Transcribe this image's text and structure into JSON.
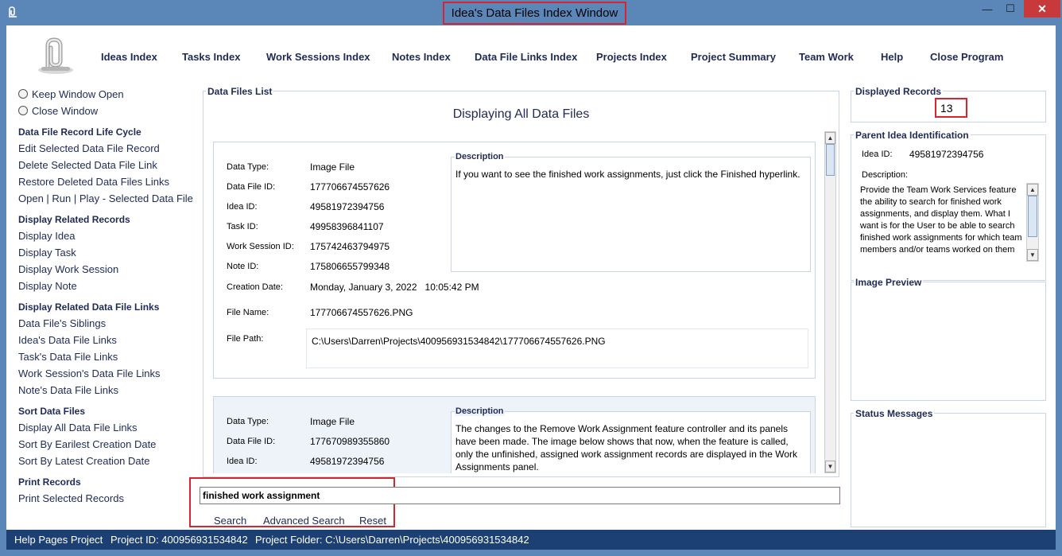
{
  "window": {
    "title": "Idea's Data Files Index Window",
    "minimize": "—",
    "maximize": "☐",
    "close": "✕"
  },
  "nav": {
    "items": [
      "Ideas Index",
      "Tasks Index",
      "Work Sessions Index",
      "Notes Index",
      "Data File Links Index",
      "Projects Index",
      "Project Summary",
      "Team Work",
      "Help",
      "Close Program"
    ]
  },
  "left_panel": {
    "radios": [
      "Keep Window Open",
      "Close Window"
    ],
    "sections": [
      {
        "heading": "Data File Record Life Cycle",
        "links": [
          "Edit Selected Data File Record",
          "Delete Selected Data File Link",
          "Restore Deleted Data Files Links",
          "Open | Run | Play - Selected Data File"
        ]
      },
      {
        "heading": "Display Related Records",
        "links": [
          "Display Idea",
          "Display Task",
          "Display Work Session",
          "Display Note"
        ]
      },
      {
        "heading": "Display Related Data File Links",
        "links": [
          "Data File's Siblings",
          "Idea's Data File Links",
          "Task's Data File Links",
          "Work Session's Data File Links",
          "Note's Data File Links"
        ]
      },
      {
        "heading": "Sort Data Files",
        "links": [
          "Display All Data File Links",
          "Sort By Earilest Creation Date",
          "Sort By Latest Creation Date"
        ]
      },
      {
        "heading": "Print Records",
        "links": [
          "Print Selected Records"
        ]
      }
    ]
  },
  "data_files_list": {
    "legend": "Data Files List",
    "heading": "Displaying All Data Files",
    "labels": {
      "data_type": "Data Type:",
      "data_file_id": "Data File ID:",
      "idea_id": "Idea ID:",
      "task_id": "Task ID:",
      "work_session_id": "Work Session ID:",
      "note_id": "Note ID:",
      "creation_date": "Creation Date:",
      "file_name": "File Name:",
      "file_path": "File Path:",
      "description": "Description"
    },
    "records": [
      {
        "data_type": "Image File",
        "data_file_id": "177706674557626",
        "idea_id": "49581972394756",
        "task_id": "49958396841107",
        "work_session_id": "175742463794975",
        "note_id": "175806655799348",
        "creation_date": "Monday, January 3, 2022   10:05:42 PM",
        "file_name": "177706674557626.PNG",
        "file_path": "C:\\Users\\Darren\\Projects\\400956931534842\\177706674557626.PNG",
        "description": "If you want to see the finished work assignments, just click the Finished hyperlink."
      },
      {
        "data_type": "Image File",
        "data_file_id": "177670989355860",
        "idea_id": "49581972394756",
        "description": "The changes to the Remove Work Assignment feature controller and its panels have been made. The image below shows that now, when the feature is called, only the unfinished, assigned work assignment records are displayed in the Work Assignments panel."
      }
    ]
  },
  "search": {
    "value": "finished work assignment",
    "search_label": "Search",
    "advanced_label": "Advanced Search",
    "reset_label": "Reset"
  },
  "right_panel": {
    "displayed_records_legend": "Displayed Records",
    "displayed_records": "13",
    "parent_legend": "Parent Idea Identification",
    "idea_id_label": "Idea ID:",
    "idea_id": "49581972394756",
    "description_label": "Description:",
    "description": "Provide the Team Work Services feature the ability to search for finished work assignments, and display them. What I want is for the User to be able to search finished work assignments for which team members and/or teams worked on them",
    "image_preview_legend": "Image Preview",
    "status_messages_legend": "Status Messages"
  },
  "status_bar": {
    "project_name": "Help Pages Project",
    "project_id": "Project ID:  400956931534842",
    "project_folder": "Project Folder: C:\\Users\\Darren\\Projects\\400956931534842"
  },
  "colors": {
    "titlebar": "#5a86b8",
    "statusbar": "#1c4073",
    "highlight": "#d9232e",
    "link": "#1f2a55"
  }
}
